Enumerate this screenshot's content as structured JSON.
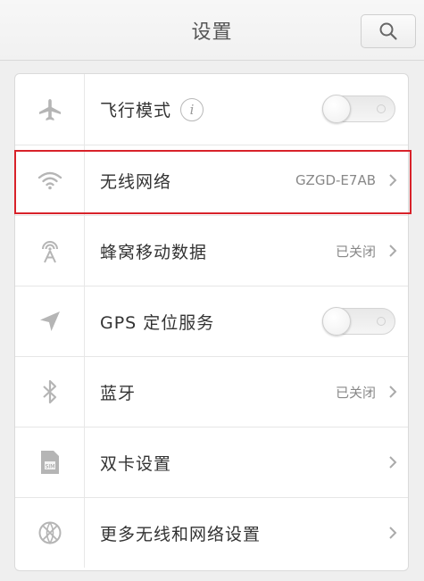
{
  "header": {
    "title": "设置"
  },
  "rows": [
    {
      "label": "飞行模式",
      "info": "i",
      "toggle": "off"
    },
    {
      "label": "无线网络",
      "value": "GZGD-E7AB"
    },
    {
      "label": "蜂窝移动数据",
      "value": "已关闭"
    },
    {
      "label": "GPS 定位服务",
      "toggle": "off"
    },
    {
      "label": "蓝牙",
      "value": "已关闭"
    },
    {
      "label": "双卡设置",
      "sim_text": "SIM"
    },
    {
      "label": "更多无线和网络设置"
    }
  ],
  "colors": {
    "highlight": "#d8222a",
    "icon": "#b5b5b5",
    "background": "#efefef"
  },
  "icons": [
    "search-icon",
    "airplane-icon",
    "wifi-icon",
    "cellular-icon",
    "location-arrow-icon",
    "bluetooth-icon",
    "sim-card-icon",
    "globe-icon",
    "chevron-right-icon",
    "info-icon"
  ]
}
